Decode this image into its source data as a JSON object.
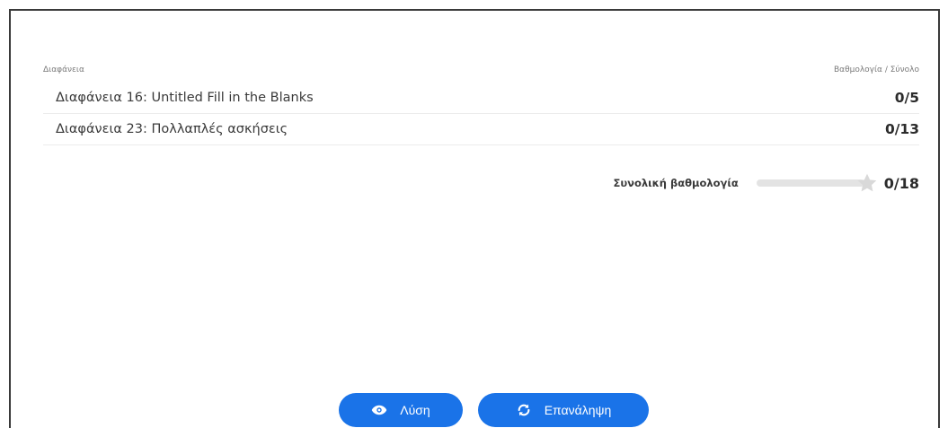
{
  "table": {
    "header_left": "Διαφάνεια",
    "header_right": "Βαθμολογία / Σύνολο",
    "rows": [
      {
        "title": "Διαφάνεια 16: Untitled Fill in the Blanks",
        "score": "0/5"
      },
      {
        "title": "Διαφάνεια 23: Πολλαπλές ασκήσεις",
        "score": "0/13"
      }
    ]
  },
  "total": {
    "label": "Συνολική βαθμολογία",
    "score": "0/18",
    "progress_fraction": 0
  },
  "buttons": {
    "solution_label": "Λύση",
    "solution_icon": "eye-icon",
    "retry_label": "Επανάληψη",
    "retry_icon": "refresh-icon"
  },
  "colors": {
    "primary": "#1a73e8",
    "progress_track": "#e3e3e3",
    "star": "#d9d9d9"
  }
}
